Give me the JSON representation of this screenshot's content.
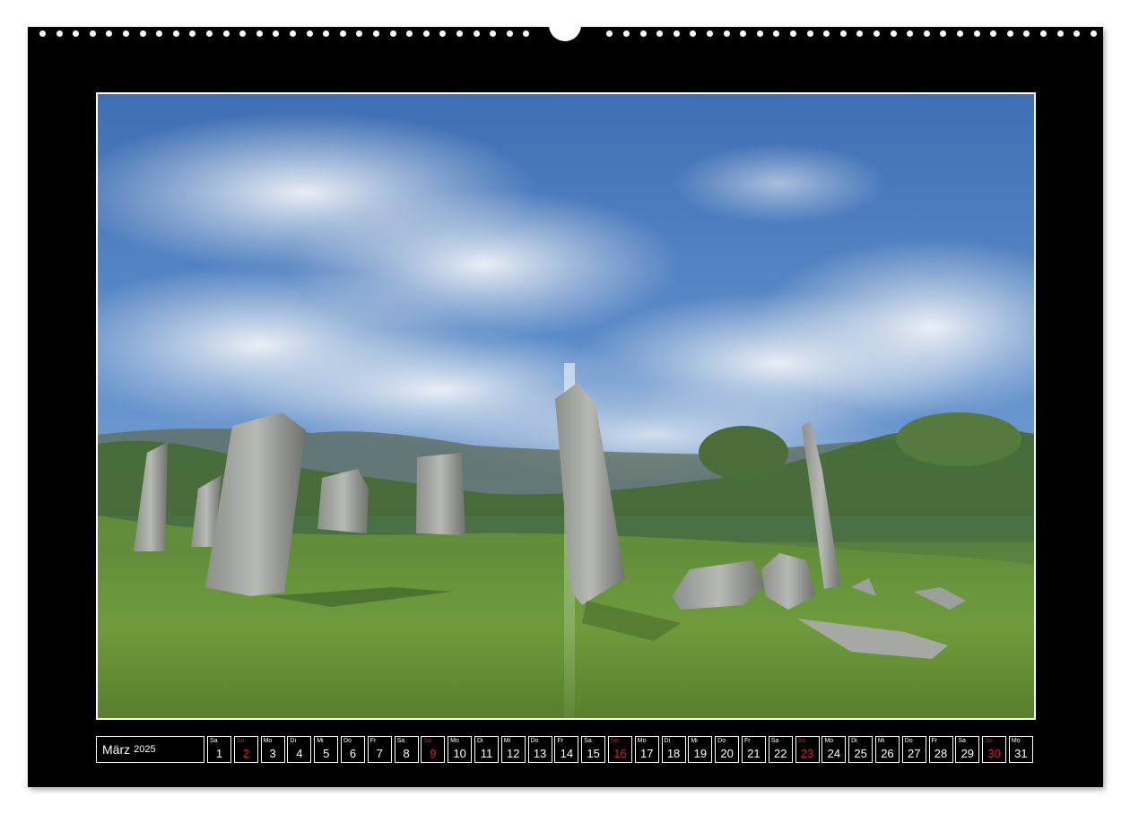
{
  "calendar": {
    "month": "März",
    "year": "2025",
    "sunday_color": "#d0213c",
    "days": [
      {
        "weekday": "Sa",
        "day": "1",
        "sunday": false
      },
      {
        "weekday": "So",
        "day": "2",
        "sunday": true
      },
      {
        "weekday": "Mo",
        "day": "3",
        "sunday": false
      },
      {
        "weekday": "Di",
        "day": "4",
        "sunday": false
      },
      {
        "weekday": "Mi",
        "day": "5",
        "sunday": false
      },
      {
        "weekday": "Do",
        "day": "6",
        "sunday": false
      },
      {
        "weekday": "Fr",
        "day": "7",
        "sunday": false
      },
      {
        "weekday": "Sa",
        "day": "8",
        "sunday": false
      },
      {
        "weekday": "So",
        "day": "9",
        "sunday": true
      },
      {
        "weekday": "Mo",
        "day": "10",
        "sunday": false
      },
      {
        "weekday": "Di",
        "day": "11",
        "sunday": false
      },
      {
        "weekday": "Mi",
        "day": "12",
        "sunday": false
      },
      {
        "weekday": "Do",
        "day": "13",
        "sunday": false
      },
      {
        "weekday": "Fr",
        "day": "14",
        "sunday": false
      },
      {
        "weekday": "Sa",
        "day": "15",
        "sunday": false
      },
      {
        "weekday": "So",
        "day": "16",
        "sunday": true
      },
      {
        "weekday": "Mo",
        "day": "17",
        "sunday": false
      },
      {
        "weekday": "Di",
        "day": "18",
        "sunday": false
      },
      {
        "weekday": "Mi",
        "day": "19",
        "sunday": false
      },
      {
        "weekday": "Do",
        "day": "20",
        "sunday": false
      },
      {
        "weekday": "Fr",
        "day": "21",
        "sunday": false
      },
      {
        "weekday": "Sa",
        "day": "22",
        "sunday": false
      },
      {
        "weekday": "So",
        "day": "23",
        "sunday": true
      },
      {
        "weekday": "Mo",
        "day": "24",
        "sunday": false
      },
      {
        "weekday": "Di",
        "day": "25",
        "sunday": false
      },
      {
        "weekday": "Mi",
        "day": "26",
        "sunday": false
      },
      {
        "weekday": "Do",
        "day": "27",
        "sunday": false
      },
      {
        "weekday": "Fr",
        "day": "28",
        "sunday": false
      },
      {
        "weekday": "Sa",
        "day": "29",
        "sunday": false
      },
      {
        "weekday": "So",
        "day": "30",
        "sunday": true
      },
      {
        "weekday": "Mo",
        "day": "31",
        "sunday": false
      }
    ]
  }
}
